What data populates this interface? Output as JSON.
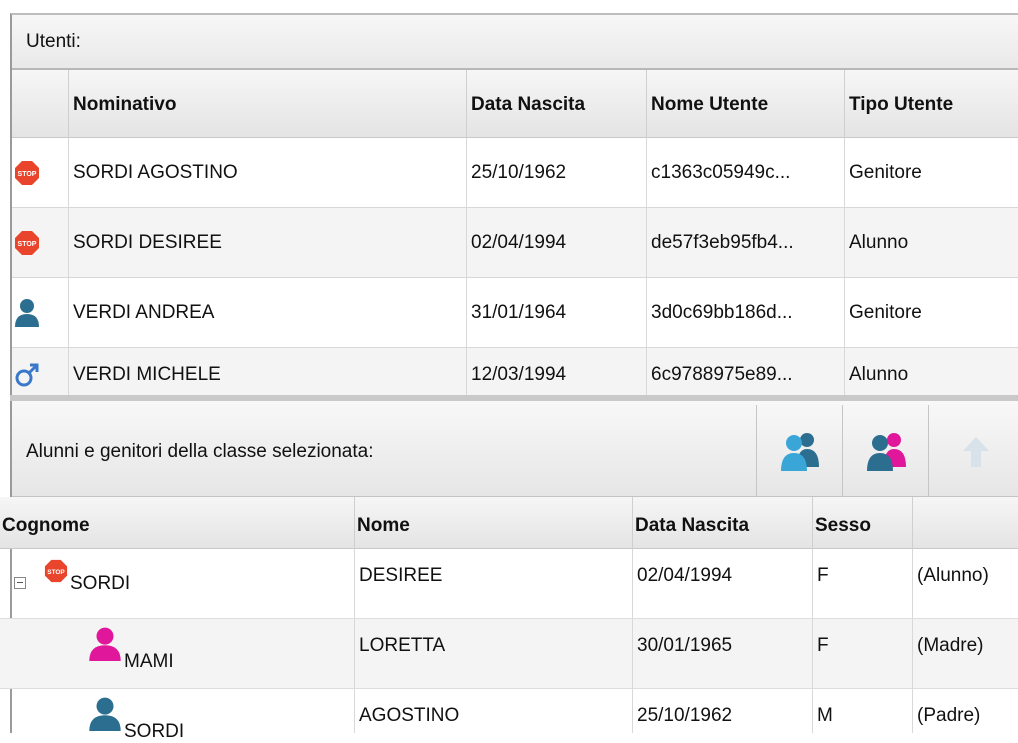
{
  "users_panel": {
    "title": "Utenti:",
    "columns": [
      "Nominativo",
      "Data Nascita",
      "Nome Utente",
      "Tipo Utente"
    ],
    "rows": [
      {
        "icon": "stop-icon",
        "name": "SORDI AGOSTINO",
        "birth": "25/10/1962",
        "username": "c1363c05949c...",
        "type": "Genitore"
      },
      {
        "icon": "stop-icon",
        "name": "SORDI DESIREE",
        "birth": "02/04/1994",
        "username": "de57f3eb95fb4...",
        "type": "Alunno"
      },
      {
        "icon": "user-blue-icon",
        "name": "VERDI ANDREA",
        "birth": "31/01/1964",
        "username": "3d0c69bb186d...",
        "type": "Genitore"
      },
      {
        "icon": "male-symbol-icon",
        "name": "VERDI MICHELE",
        "birth": "12/03/1994",
        "username": "6c9788975e89...",
        "type": "Alunno"
      }
    ]
  },
  "class_panel": {
    "title": "Alunni e genitori della classe selezionata:",
    "columns": [
      "Cognome",
      "Nome",
      "Data Nascita",
      "Sesso",
      ""
    ],
    "rows": [
      {
        "icon": "stop-icon",
        "surname": "SORDI",
        "name": "DESIREE",
        "birth": "02/04/1994",
        "sex": "F",
        "role": "(Alunno)"
      },
      {
        "icon": "user-female-icon",
        "surname": "MAMI",
        "name": "LORETTA",
        "birth": "30/01/1965",
        "sex": "F",
        "role": "(Madre)"
      },
      {
        "icon": "user-blue-icon",
        "surname": "SORDI",
        "name": "AGOSTINO",
        "birth": "25/10/1962",
        "sex": "M",
        "role": "(Padre)"
      }
    ]
  },
  "colors": {
    "stop": "#e8452c",
    "user_blue": "#2c6e8f",
    "user_female": "#e0179a",
    "male_symbol": "#3a78c9",
    "toolbar_blue": "#3aa6d8"
  }
}
